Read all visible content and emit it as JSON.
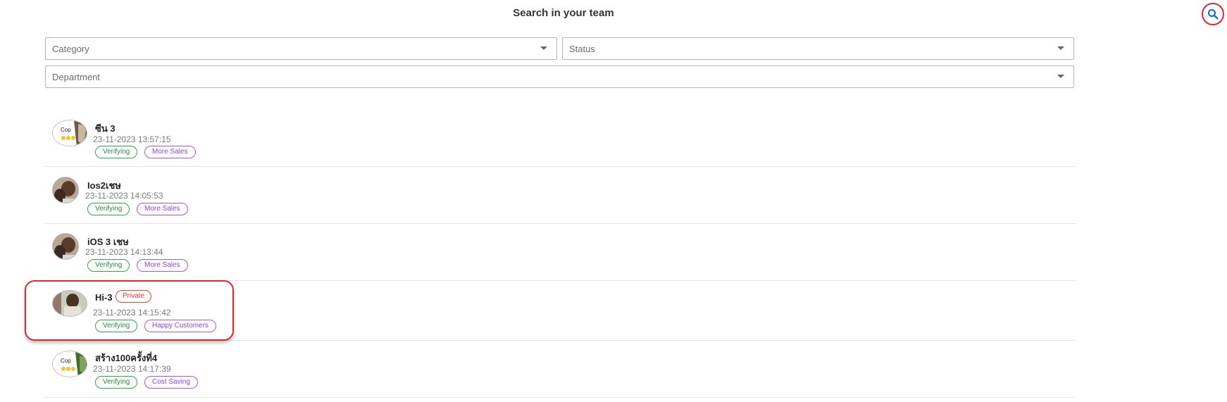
{
  "page": {
    "title": "Search in your team"
  },
  "search_button": {
    "icon": "search-icon",
    "accent": "#1565c0",
    "ring": "#e0262f"
  },
  "filters": {
    "category": {
      "placeholder": "Category"
    },
    "status": {
      "placeholder": "Status"
    },
    "department": {
      "placeholder": "Department"
    }
  },
  "items": [
    {
      "name": "ซีน 3",
      "time": "23-11-2023 13:57:15",
      "status": "Verifying",
      "category": "More Sales",
      "private": ""
    },
    {
      "name": "Ios2เชษ",
      "time": "23-11-2023 14:05:53",
      "status": "Verifying",
      "category": "More Sales",
      "private": ""
    },
    {
      "name": "iOS 3 เชษ",
      "time": "23-11-2023 14:13:44",
      "status": "Verifying",
      "category": "More Sales",
      "private": ""
    },
    {
      "name": "Hi-3",
      "time": "23-11-2023 14:15:42",
      "status": "Verifying",
      "category": "Happy Customers",
      "private": "Private"
    },
    {
      "name": "สร้าง100ครั้งที่4",
      "time": "23-11-2023 14:17:39",
      "status": "Verifying",
      "category": "Cost Saving",
      "private": ""
    }
  ],
  "avatar_badge": {
    "line1": "Cop",
    "line2": "😊😊"
  }
}
